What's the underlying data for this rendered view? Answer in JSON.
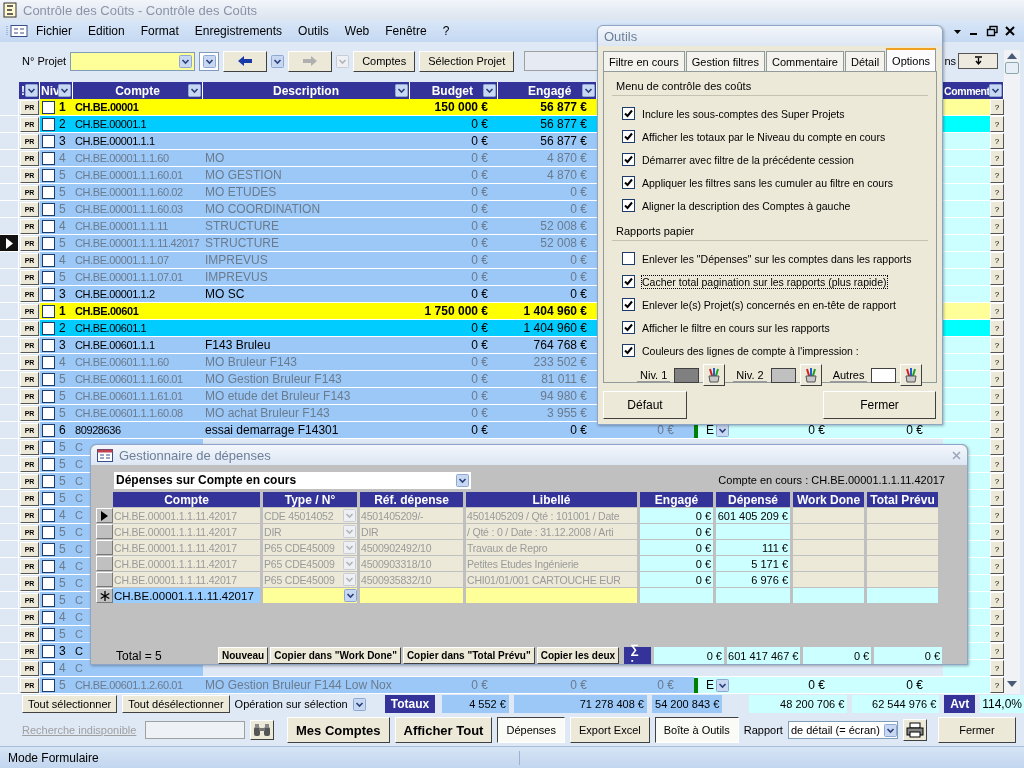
{
  "window": {
    "title": "Contrôle des Coûts - Contrôle des Coûts"
  },
  "menu": [
    "Fichier",
    "Edition",
    "Format",
    "Enregistrements",
    "Outils",
    "Web",
    "Fenêtre",
    "?"
  ],
  "toolbar": {
    "project_label": "N° Projet",
    "back_disabled": false,
    "forward_disabled": true,
    "buttons": [
      "Comptes",
      "Sélection Projet"
    ],
    "partial_label": "ns"
  },
  "table": {
    "columns": [
      "!",
      "Niv",
      "Compte",
      "Description",
      "Budget",
      "Engagé"
    ],
    "comment_column": "Comment",
    "rows": [
      {
        "pr": "PR",
        "checked": false,
        "selected": false,
        "kind": "total1",
        "niv": "1",
        "compte": "CH.BE.00001",
        "budget": "150 000 €",
        "engage": "56 877 €",
        "q": "?"
      },
      {
        "pr": "PR",
        "checked": false,
        "selected": false,
        "kind": "total2",
        "niv": "2",
        "compte": "CH.BE.00001.1",
        "budget": "0 €",
        "engage": "56 877 €",
        "q": "?"
      },
      {
        "pr": "PR",
        "checked": false,
        "selected": false,
        "kind": "normal",
        "niv": "3",
        "compte": "CH.BE.00001.1.1",
        "budget": "0 €",
        "engage": "56 877 €",
        "q": "?"
      },
      {
        "pr": "PR",
        "checked": false,
        "selected": false,
        "kind": "dim",
        "niv": "4",
        "compte": "CH.BE.00001.1.1.60",
        "description": "MO",
        "budget": "0 €",
        "engage": "4 870 €",
        "q": "?"
      },
      {
        "pr": "PR",
        "checked": false,
        "selected": false,
        "kind": "dim",
        "niv": "5",
        "compte": "CH.BE.00001.1.1.60.01",
        "description": "MO GESTION",
        "budget": "0 €",
        "engage": "4 870 €",
        "q": "?"
      },
      {
        "pr": "PR",
        "checked": false,
        "selected": false,
        "kind": "dim",
        "niv": "5",
        "compte": "CH.BE.00001.1.1.60.02",
        "description": "MO ETUDES",
        "budget": "0 €",
        "engage": "0 €",
        "q": "?"
      },
      {
        "pr": "PR",
        "checked": false,
        "selected": false,
        "kind": "dim",
        "niv": "5",
        "compte": "CH.BE.00001.1.1.60.03",
        "description": "MO COORDINATION",
        "budget": "0 €",
        "engage": "0 €",
        "q": "?"
      },
      {
        "pr": "PR",
        "checked": false,
        "selected": false,
        "kind": "dim",
        "niv": "4",
        "compte": "CH.BE.00001.1.1.11",
        "description": "STRUCTURE",
        "budget": "0 €",
        "engage": "52 008 €",
        "q": "?"
      },
      {
        "pr": "PR",
        "checked": false,
        "selected": true,
        "kind": "dim",
        "niv": "5",
        "compte": "CH.BE.00001.1.1.11.42017",
        "description": "STRUCTURE",
        "budget": "0 €",
        "engage": "52 008 €",
        "q": "?"
      },
      {
        "pr": "PR",
        "checked": false,
        "selected": false,
        "kind": "dim",
        "niv": "4",
        "compte": "CH.BE.00001.1.1.07",
        "description": "IMPREVUS",
        "budget": "0 €",
        "engage": "0 €",
        "q": "?"
      },
      {
        "pr": "PR",
        "checked": false,
        "selected": false,
        "kind": "dim",
        "niv": "5",
        "compte": "CH.BE.00001.1.1.07.01",
        "description": "IMPREVUS",
        "budget": "0 €",
        "engage": "0 €",
        "q": "?"
      },
      {
        "pr": "PR",
        "checked": false,
        "selected": false,
        "kind": "normal",
        "niv": "3",
        "compte": "CH.BE.00001.1.2",
        "description": "MO SC",
        "budget": "0 €",
        "engage": "0 €",
        "q": "?"
      },
      {
        "pr": "PR",
        "checked": false,
        "selected": false,
        "kind": "total1",
        "niv": "1",
        "compte": "CH.BE.00601",
        "budget": "1 750 000 €",
        "engage": "1 404 960 €",
        "q": "?"
      },
      {
        "pr": "PR",
        "checked": false,
        "selected": false,
        "kind": "total2",
        "niv": "2",
        "compte": "CH.BE.00601.1",
        "budget": "0 €",
        "engage": "1 404 960 €",
        "q": "?"
      },
      {
        "pr": "PR",
        "checked": false,
        "selected": false,
        "kind": "normal",
        "niv": "3",
        "compte": "CH.BE.00601.1.1",
        "description": "F143 Bruleu",
        "budget": "0 €",
        "engage": "764 768 €",
        "q": "?"
      },
      {
        "pr": "PR",
        "checked": false,
        "selected": false,
        "kind": "dim",
        "niv": "4",
        "compte": "CH.BE.00601.1.1.60",
        "description": "MO Bruleur F143",
        "budget": "0 €",
        "engage": "233 502 €",
        "q": "?"
      },
      {
        "pr": "PR",
        "checked": false,
        "selected": false,
        "kind": "dim",
        "niv": "5",
        "compte": "CH.BE.00601.1.1.60.01",
        "description": "MO Gestion Bruleur F143",
        "budget": "0 €",
        "engage": "81 011 €",
        "q": "?"
      },
      {
        "pr": "PR",
        "checked": false,
        "selected": false,
        "kind": "dim",
        "niv": "5",
        "compte": "CH.BE.00601.1.1.61.01",
        "description": "MO etude det Bruleur F143",
        "budget": "0 €",
        "engage": "94 980 €",
        "q": "?"
      },
      {
        "pr": "PR",
        "checked": false,
        "selected": false,
        "kind": "dim",
        "niv": "5",
        "compte": "CH.BE.00601.1.1.60.08",
        "description": "MO achat Bruleur F143",
        "budget": "0 €",
        "engage": "3 955 €",
        "q": "?"
      },
      {
        "pr": "PR",
        "checked": false,
        "selected": false,
        "kind": "normal",
        "niv": "6",
        "compte": "80928636",
        "description": "essai demarrage F14301",
        "budget": "0 €",
        "engage": "0 €",
        "column_7": "0 €",
        "color": "#008000",
        "code": "E",
        "column_10": "0 €",
        "column_11": "0 €",
        "q": "?"
      },
      {
        "pr": "PR",
        "checked": false,
        "selected": false,
        "kind": "dim",
        "niv": "5",
        "compte": "C",
        "q": "?"
      },
      {
        "pr": "PR",
        "checked": false,
        "selected": false,
        "kind": "dim",
        "niv": "5",
        "compte": "C",
        "q": "?"
      },
      {
        "pr": "PR",
        "checked": false,
        "selected": false,
        "kind": "dim",
        "niv": "5",
        "compte": "C",
        "q": "?"
      },
      {
        "pr": "PR",
        "checked": false,
        "selected": false,
        "kind": "dim",
        "niv": "5",
        "compte": "C",
        "q": "?"
      },
      {
        "pr": "PR",
        "checked": false,
        "selected": false,
        "kind": "dim",
        "niv": "4",
        "compte": "C",
        "q": "?"
      },
      {
        "pr": "PR",
        "checked": false,
        "selected": false,
        "kind": "dim",
        "niv": "5",
        "compte": "C",
        "q": "?"
      },
      {
        "pr": "PR",
        "checked": false,
        "selected": false,
        "kind": "dim",
        "niv": "5",
        "compte": "C",
        "q": "?"
      },
      {
        "pr": "PR",
        "checked": false,
        "selected": false,
        "kind": "dim",
        "niv": "4",
        "compte": "C",
        "q": "?"
      },
      {
        "pr": "PR",
        "checked": false,
        "selected": false,
        "kind": "dim",
        "niv": "5",
        "compte": "C",
        "q": "?"
      },
      {
        "pr": "PR",
        "checked": false,
        "selected": false,
        "kind": "dim",
        "niv": "5",
        "compte": "C",
        "q": "?"
      },
      {
        "pr": "PR",
        "checked": false,
        "selected": false,
        "kind": "dim",
        "niv": "4",
        "compte": "C",
        "q": "?"
      },
      {
        "pr": "PR",
        "checked": false,
        "selected": false,
        "kind": "dim",
        "niv": "5",
        "compte": "C",
        "q": "?"
      },
      {
        "pr": "PR",
        "checked": false,
        "selected": false,
        "kind": "normal",
        "niv": "3",
        "compte": "C",
        "q": "?"
      },
      {
        "pr": "PR",
        "checked": false,
        "selected": false,
        "kind": "dim",
        "niv": "4",
        "compte": "C",
        "q": "?"
      },
      {
        "pr": "PR",
        "checked": false,
        "selected": false,
        "kind": "dim",
        "niv": "5",
        "compte": "CH.BE.00601.1.2.60.01",
        "description": "MO Gestion Bruleur F144 Low Nox",
        "budget": "0 €",
        "engage": "0 €",
        "column_7": "0 €",
        "color": "#008000",
        "code": "E",
        "column_10": "0 €",
        "column_11": "0 €",
        "q": "?"
      }
    ]
  },
  "footer": {
    "selection_buttons": [
      "Tout sélectionner",
      "Tout désélectionner"
    ],
    "operation_label": "Opération sur sélection",
    "totals_label": "Totaux",
    "totals": [
      "4 552 €",
      "71 278 408 €",
      "54 200 843 €",
      "48 200 706 €",
      "62 544 976 €"
    ],
    "avt_label": "Avt",
    "avt_value": "114,0%",
    "search_label": "Recherche indisponible",
    "buttons": [
      {
        "label": "Mes Comptes",
        "kind": "bold",
        "pressed": false
      },
      {
        "label": "Afficher Tout",
        "kind": "bold",
        "pressed": false
      },
      {
        "label": "Dépenses",
        "kind": "plain",
        "pressed": true
      },
      {
        "label": "Export Excel",
        "kind": "plain",
        "pressed": false
      },
      {
        "label": "Boîte à Outils",
        "kind": "plain",
        "pressed": true
      }
    ],
    "report_label": "Rapport",
    "report_value": "de détail (= écran)",
    "close_button": "Fermer"
  },
  "status_bar": "Mode Formulaire",
  "outils": {
    "title": "Outils",
    "tabs": [
      {
        "label": "Filtre en cours",
        "selected": false
      },
      {
        "label": "Gestion filtres",
        "selected": false
      },
      {
        "label": "Commentaire",
        "selected": false
      },
      {
        "label": "Détail",
        "selected": false
      },
      {
        "label": "Options",
        "selected": true
      }
    ],
    "sections": [
      {
        "title": "Menu de contrôle des coûts",
        "options": [
          {
            "label": "Inclure les sous-comptes des Super Projets",
            "checked": true,
            "focused": false
          },
          {
            "label": "Afficher les totaux par le Niveau du compte en cours",
            "checked": true,
            "focused": false
          },
          {
            "label": "Démarrer avec filtre de la précédente cession",
            "checked": true,
            "focused": false
          },
          {
            "label": "Appliquer les filtres sans les cumuler au filtre en cours",
            "checked": true,
            "focused": false
          },
          {
            "label": "Aligner la description des Comptes à gauche",
            "checked": true,
            "focused": false
          }
        ]
      },
      {
        "title": "Rapports papier",
        "options": [
          {
            "label": "Enlever les \"Dépenses\" sur les comptes dans les rapports",
            "checked": false,
            "focused": false
          },
          {
            "label": "Cacher total pagination sur les rapports (plus rapide)",
            "checked": true,
            "focused": true
          },
          {
            "label": "Enlever le(s) Projet(s) concernés en en-tête de rapport",
            "checked": true,
            "focused": false
          },
          {
            "label": "Afficher le filtre en cours sur les rapports",
            "checked": true,
            "focused": false
          },
          {
            "label": "Couleurs des lignes de compte à l'impression :",
            "checked": true,
            "focused": false
          }
        ]
      }
    ],
    "colors": [
      {
        "label": "Niv. 1",
        "color": "#808080"
      },
      {
        "label": "Niv. 2",
        "color": "#c0c0c0"
      },
      {
        "label": "Autres",
        "color": "#ffffff"
      }
    ],
    "buttons": [
      "Défaut",
      "Fermer"
    ]
  },
  "depenses": {
    "title": "Gestionnaire de dépenses",
    "filter": "Dépenses sur Compte en cours",
    "current_account": "Compte en cours : CH.BE.00001.1.1.11.42017",
    "columns": [
      "Compte",
      "Type / N°",
      "Réf. dépense",
      "Libellé",
      "Engagé",
      "Dépensé",
      "Work Done",
      "Total Prévu"
    ],
    "rows": [
      {
        "selected": true,
        "compte": "CH.BE.00001.1.1.11.42017",
        "type": "CDE 45014052",
        "ref": "4501405209/-",
        "libelle": "4501405209 / Qté : 101001 / Date",
        "engage": "0 €",
        "depense": "601 405 209 €"
      },
      {
        "selected": false,
        "compte": "CH.BE.00001.1.1.11.42017",
        "type": "DIR",
        "ref": "DIR",
        "libelle": "/ Qté : 0 / Date : 31.12.2008 / Arti",
        "engage": "0 €"
      },
      {
        "selected": false,
        "compte": "CH.BE.00001.1.1.11.42017",
        "type": "P65 CDE45009",
        "ref": "4500902492/10",
        "libelle": "Travaux de Repro",
        "engage": "0 €",
        "depense": "111 €"
      },
      {
        "selected": false,
        "compte": "CH.BE.00001.1.1.11.42017",
        "type": "P65 CDE45009",
        "ref": "4500903318/10",
        "libelle": "Petites Etudes Ingénierie",
        "engage": "0 €",
        "depense": "5 171 €"
      },
      {
        "selected": false,
        "compte": "CH.BE.00001.1.1.11.42017",
        "type": "P65 CDE45009",
        "ref": "4500935832/10",
        "libelle": "CHI01/01/001 CARTOUCHE EUR",
        "engage": "0 €",
        "depense": "6 976 €"
      }
    ],
    "new_row": {
      "compte": "CH.BE.00001.1.1.11.42017"
    },
    "total": "Total = 5",
    "buttons": [
      "Nouveau",
      "Copier dans \"Work Done\"",
      "Copier dans \"Total Prévu\"",
      "Copier les deux"
    ],
    "sum_label": "∑ :",
    "sums": [
      "0 €",
      "601 417 467 €",
      "0 €",
      "0 €"
    ]
  }
}
